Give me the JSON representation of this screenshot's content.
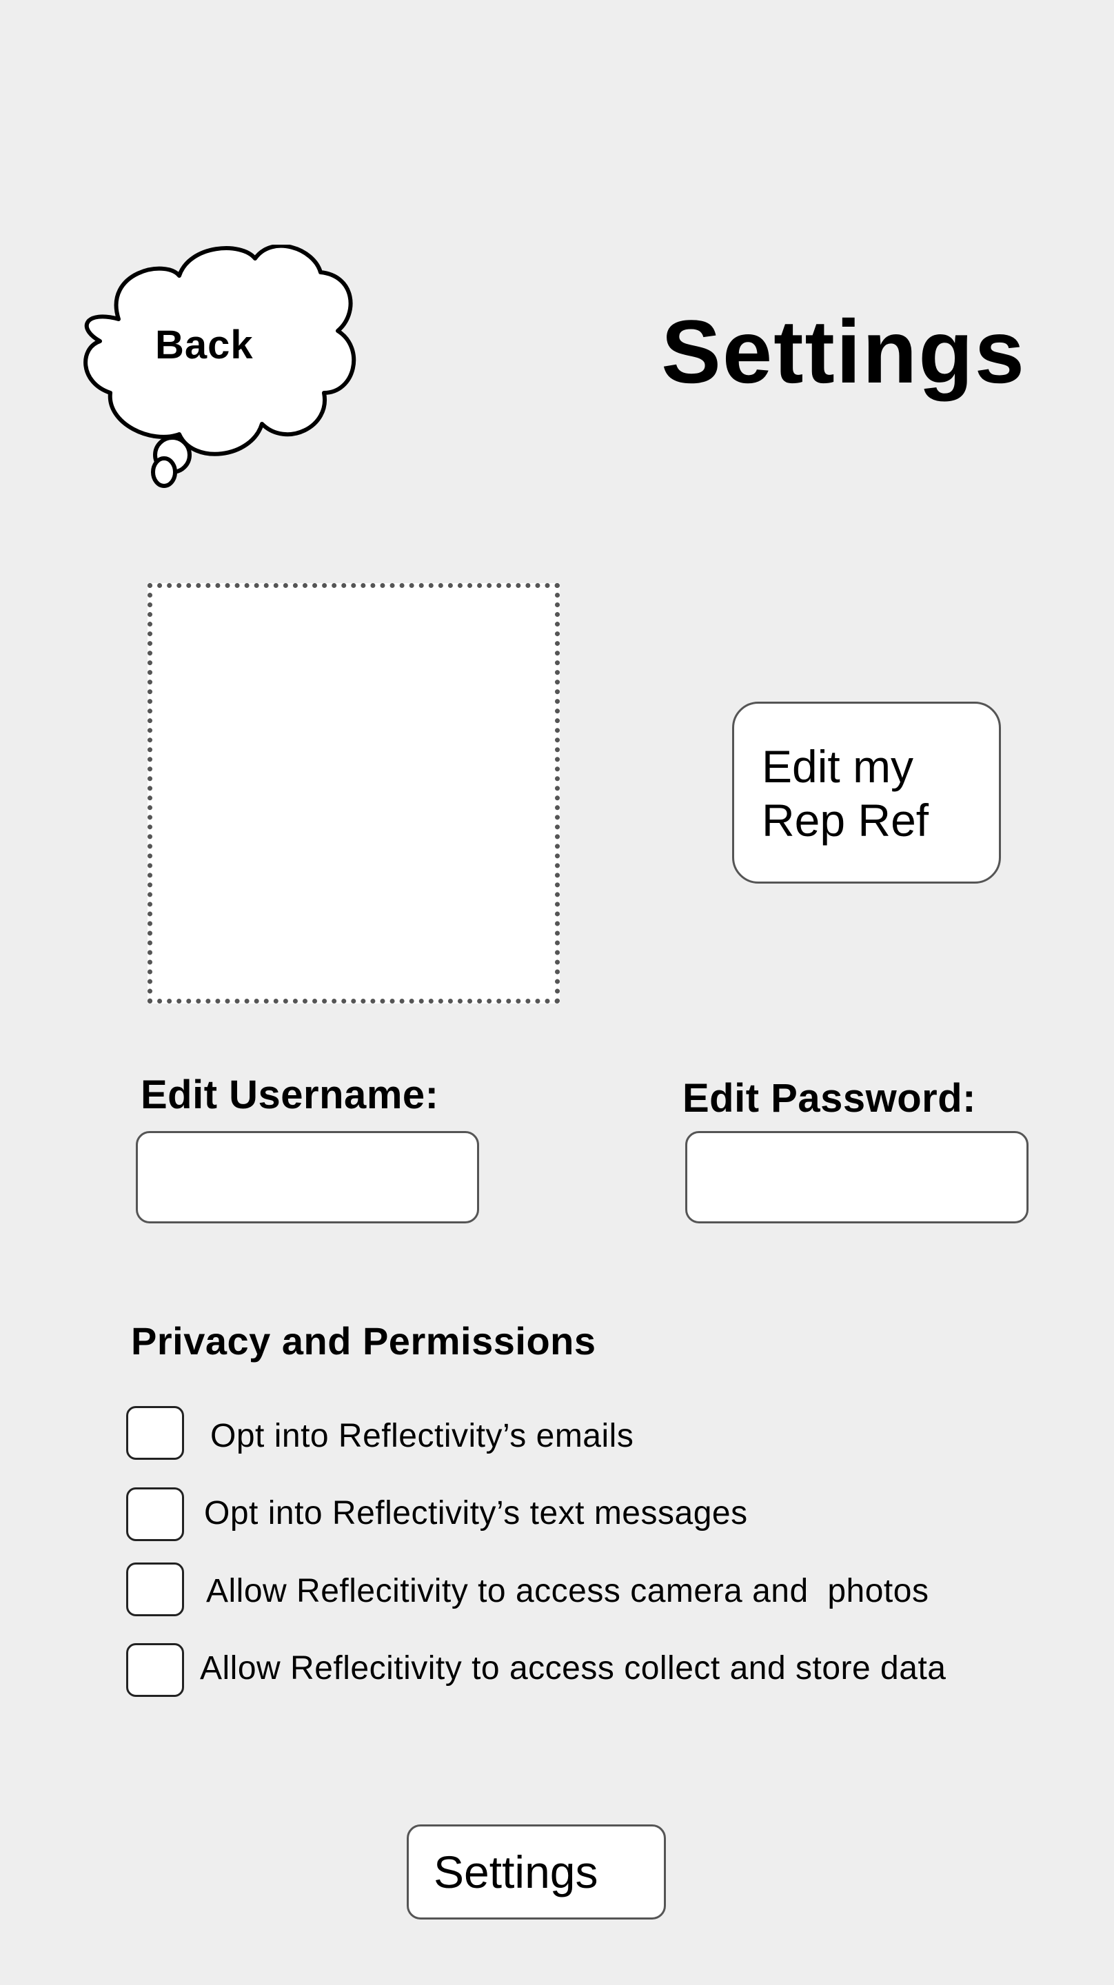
{
  "header": {
    "back_label": "Back",
    "title": "Settings"
  },
  "profile": {
    "edit_rep_line1": "Edit my",
    "edit_rep_line2": "Rep Ref"
  },
  "account": {
    "username_label": "Edit Username:",
    "username_value": "",
    "password_label": "Edit Password:",
    "password_value": ""
  },
  "privacy": {
    "title": "Privacy and Permissions",
    "items": [
      {
        "label": "Opt into Reflectivity’s emails",
        "checked": false
      },
      {
        "label": "Opt into Reflectivity’s text messages",
        "checked": false
      },
      {
        "label": "Allow Reflecitivity to access camera and  photos",
        "checked": false
      },
      {
        "label": "Allow Reflecitivity to access collect and store data",
        "checked": false
      }
    ]
  },
  "footer": {
    "button_label": "Settings"
  },
  "icons": {
    "back": "thought-cloud-icon",
    "checkbox": "checkbox-icon"
  }
}
